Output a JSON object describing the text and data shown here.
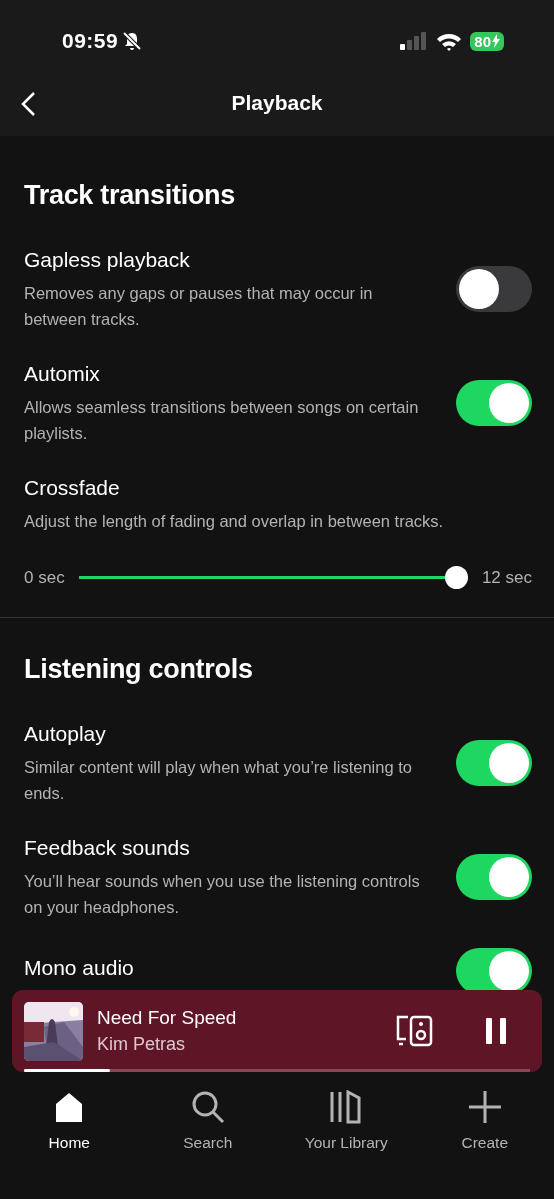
{
  "status_bar": {
    "time": "09:59",
    "battery": "80"
  },
  "header": {
    "title": "Playback"
  },
  "sections": [
    {
      "title": "Track transitions",
      "items": [
        {
          "kind": "toggle",
          "title": "Gapless playback",
          "description": "Removes any gaps or pauses that may occur in between tracks.",
          "on": false
        },
        {
          "kind": "toggle",
          "title": "Automix",
          "description": "Allows seamless transitions between songs on certain playlists.",
          "on": true
        },
        {
          "kind": "slider",
          "title": "Crossfade",
          "description": "Adjust the length of fading and overlap in between tracks.",
          "min_label": "0 sec",
          "max_label": "12 sec",
          "level": 1
        }
      ]
    },
    {
      "title": "Listening controls",
      "items": [
        {
          "kind": "toggle",
          "title": "Autoplay",
          "description": "Similar content will play when what you’re listening to ends.",
          "on": true
        },
        {
          "kind": "toggle",
          "title": "Feedback sounds",
          "description": "You’ll hear sounds when you use the listening controls on your headphones.",
          "on": true
        },
        {
          "kind": "toggle",
          "title": "Mono audio",
          "on": true
        }
      ]
    }
  ],
  "now_playing": {
    "title": "Need For Speed",
    "artist": "Kim Petras",
    "playing": true,
    "level": 0.17
  },
  "nav": [
    {
      "kind": "home",
      "label": "Home",
      "selected": true
    },
    {
      "kind": "search",
      "label": "Search",
      "selected": false
    },
    {
      "kind": "library",
      "label": "Your Library",
      "selected": false
    },
    {
      "kind": "create",
      "label": "Create",
      "selected": false
    }
  ]
}
